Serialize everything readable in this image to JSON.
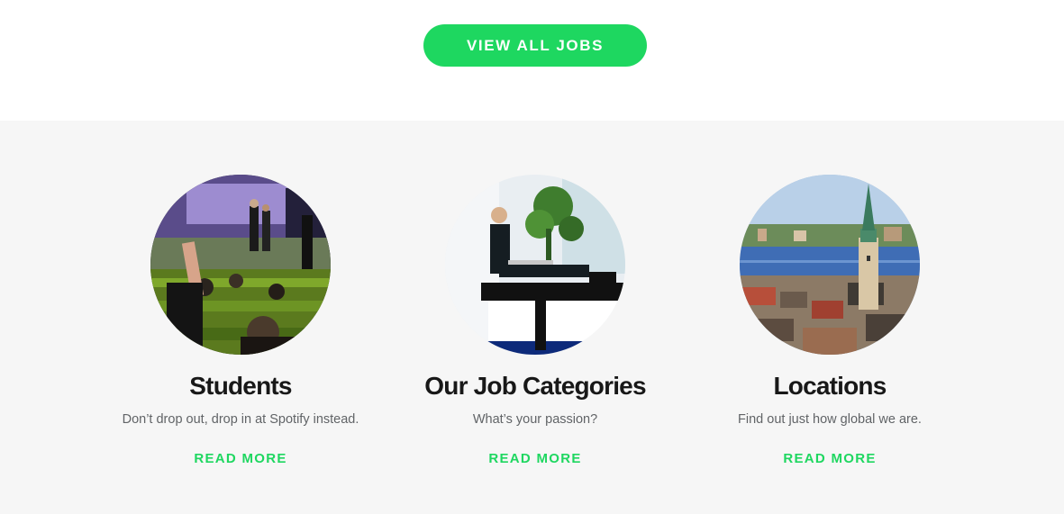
{
  "cta": {
    "label": "VIEW ALL JOBS"
  },
  "cards": [
    {
      "title": "Students",
      "subtitle": "Don’t drop out, drop in at Spotify instead.",
      "link": "READ MORE",
      "image": "classroom-photo"
    },
    {
      "title": "Our Job Categories",
      "subtitle": "What’s your passion?",
      "link": "READ MORE",
      "image": "office-worker-photo"
    },
    {
      "title": "Locations",
      "subtitle": "Find out just how global we are.",
      "link": "READ MORE",
      "image": "stockholm-city-photo"
    }
  ],
  "colors": {
    "accent": "#1ed760",
    "band": "#f6f6f6",
    "title": "#181818",
    "subtitle": "#616467"
  }
}
